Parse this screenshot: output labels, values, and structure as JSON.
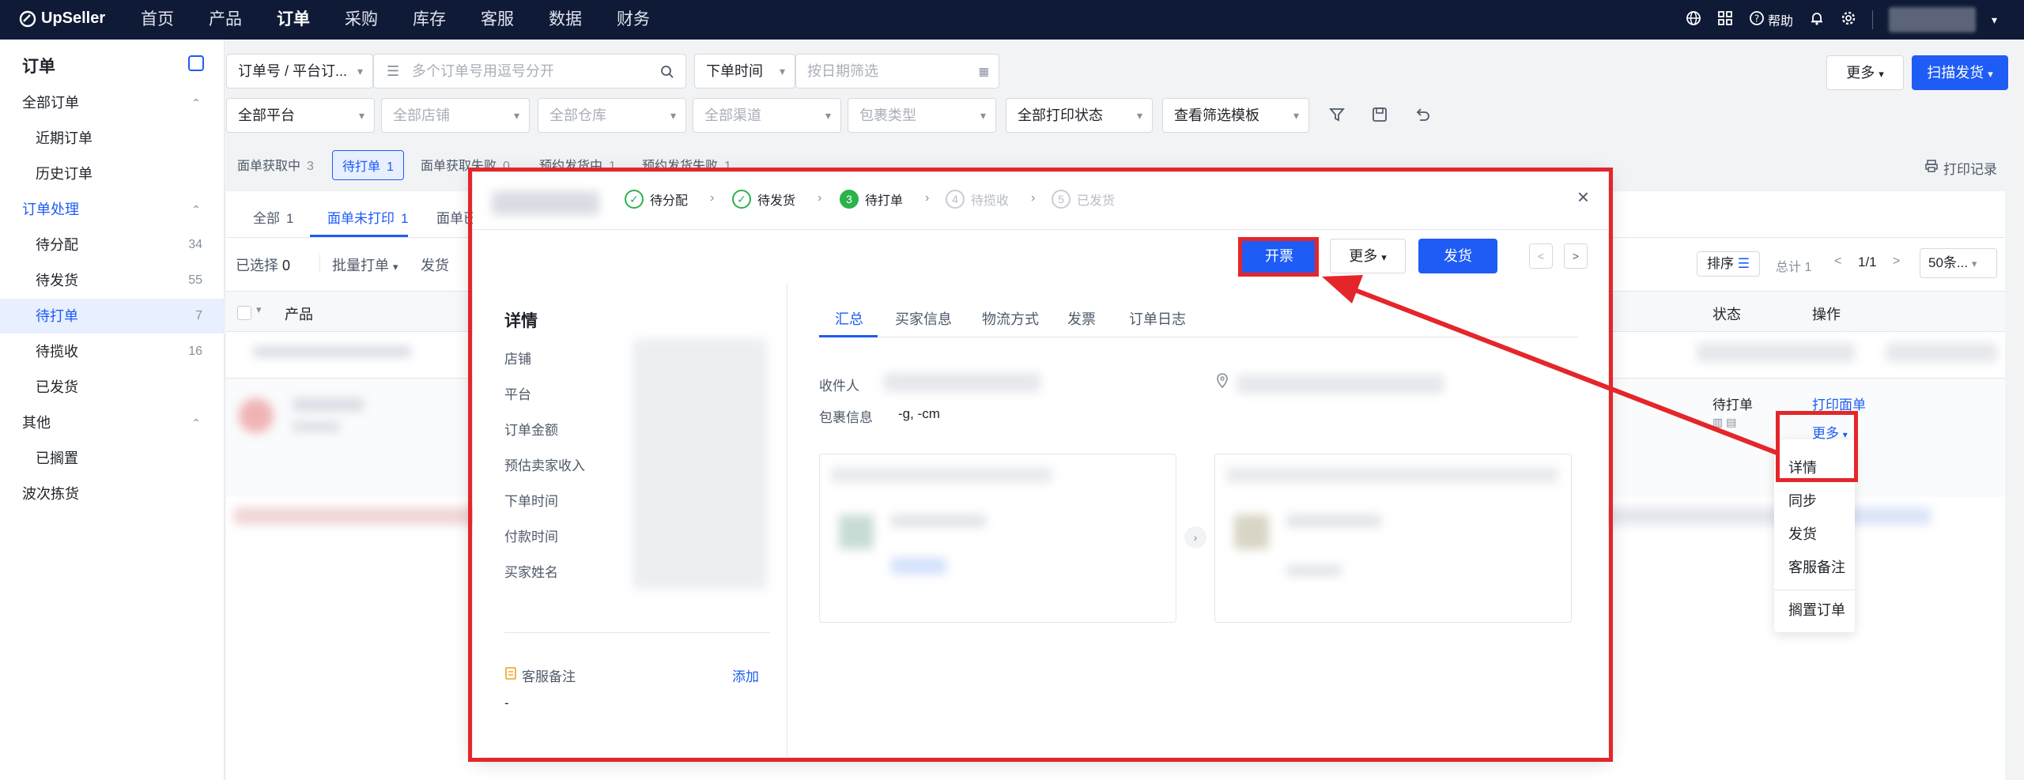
{
  "topbar": {
    "logo": "UpSeller",
    "nav": [
      "首页",
      "产品",
      "订单",
      "采购",
      "库存",
      "客服",
      "数据",
      "财务"
    ],
    "active_index": 2,
    "help_label": "帮助"
  },
  "sidebar": {
    "title": "订单",
    "groups": [
      {
        "label": "全部订单",
        "items": [
          {
            "label": "近期订单",
            "count": ""
          },
          {
            "label": "历史订单",
            "count": ""
          }
        ]
      },
      {
        "label": "订单处理",
        "items": [
          {
            "label": "待分配",
            "count": "34"
          },
          {
            "label": "待发货",
            "count": "55"
          },
          {
            "label": "待打单",
            "count": "7"
          },
          {
            "label": "待揽收",
            "count": "16"
          },
          {
            "label": "已发货",
            "count": ""
          }
        ]
      },
      {
        "label": "其他",
        "items": [
          {
            "label": "已搁置",
            "count": ""
          }
        ]
      },
      {
        "label": "波次拣货",
        "items": []
      }
    ]
  },
  "filters": {
    "search_type": "订单号 / 平台订...",
    "search_placeholder": "多个订单号用逗号分开",
    "time_type": "下单时间",
    "date_placeholder": "按日期筛选",
    "more_label": "更多",
    "scan_ship_label": "扫描发货",
    "platform": "全部平台",
    "shop_placeholder": "全部店铺",
    "warehouse_placeholder": "全部仓库",
    "channel_placeholder": "全部渠道",
    "package_placeholder": "包裹类型",
    "print_status": "全部打印状态",
    "template_label": "查看筛选模板"
  },
  "status_tabs": [
    {
      "label": "面单获取中",
      "count": "3"
    },
    {
      "label": "待打单",
      "count": "1"
    },
    {
      "label": "面单获取失败",
      "count": "0"
    },
    {
      "label": "预约发货中",
      "count": "1"
    },
    {
      "label": "预约发货失败",
      "count": "1"
    }
  ],
  "print_log_label": "打印记录",
  "table": {
    "subtabs": [
      {
        "label": "全部",
        "count": "1"
      },
      {
        "label": "面单未打印",
        "count": "1"
      },
      {
        "label": "面单已",
        "count": ""
      }
    ],
    "selected_label": "已选择",
    "selected_count": "0",
    "batch_print_label": "批量打单",
    "ship_label": "发货",
    "sort_label": "排序",
    "total_label": "总计 1",
    "page_label": "1/1",
    "page_size_label": "50条...",
    "col_product": "产品",
    "col_status": "状态",
    "col_action": "操作",
    "row_status": "待打单",
    "row_action_print": "打印面单",
    "row_action_more": "更多"
  },
  "row_menu": [
    "详情",
    "同步",
    "发货",
    "客服备注",
    "搁置订单"
  ],
  "modal": {
    "steps": [
      {
        "num": "1",
        "label": "待分配",
        "state": "done"
      },
      {
        "num": "2",
        "label": "待发货",
        "state": "done"
      },
      {
        "num": "3",
        "label": "待打单",
        "state": "current"
      },
      {
        "num": "4",
        "label": "待揽收",
        "state": "todo"
      },
      {
        "num": "5",
        "label": "已发货",
        "state": "todo"
      }
    ],
    "invoice_label": "开票",
    "more_label": "更多",
    "ship_label": "发货",
    "details_title": "详情",
    "detail_fields": [
      "店铺",
      "平台",
      "订单金额",
      "预估卖家收入",
      "下单时间",
      "付款时间",
      "买家姓名"
    ],
    "tabs": [
      "汇总",
      "买家信息",
      "物流方式",
      "发票",
      "订单日志"
    ],
    "recipient_label": "收件人",
    "package_info_label": "包裹信息",
    "package_info_value": "-g, -cm",
    "cs_note_label": "客服备注",
    "add_label": "添加",
    "cs_note_value": "-"
  },
  "colors": {
    "accent": "#1e5cf5",
    "topbar": "#0f1a36",
    "annotation_red": "#e4262a",
    "success": "#2bb24c"
  }
}
